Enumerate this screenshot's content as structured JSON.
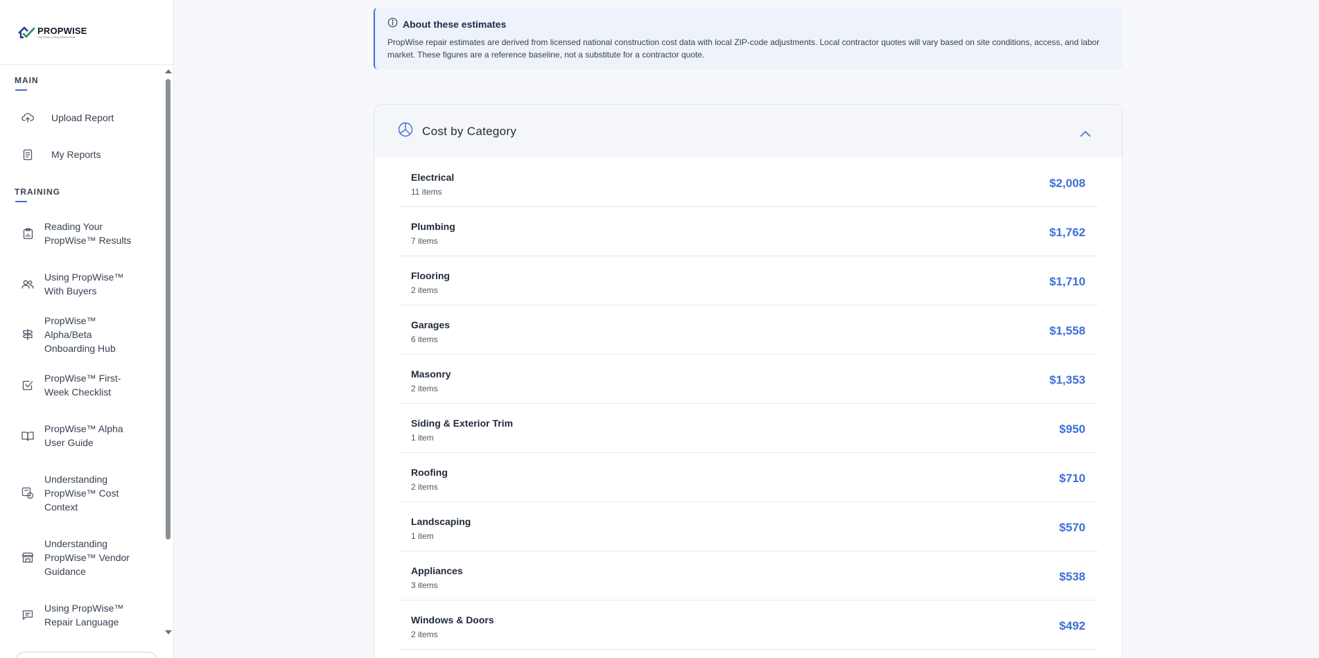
{
  "brand": {
    "name": "PROPWISE",
    "tagline": "The Power to Buy What's Real"
  },
  "sidebar": {
    "sections": [
      {
        "label": "MAIN"
      },
      {
        "label": "TRAINING"
      }
    ],
    "main_items": [
      {
        "label": "Upload Report",
        "icon": "upload-cloud-icon"
      },
      {
        "label": "My Reports",
        "icon": "document-icon"
      }
    ],
    "training_items": [
      {
        "label": "Reading Your PropWise™ Results",
        "icon": "report-chart-icon"
      },
      {
        "label": "Using PropWise™ With Buyers",
        "icon": "users-icon"
      },
      {
        "label": "PropWise™ Alpha/Beta Onboarding Hub",
        "icon": "signpost-icon"
      },
      {
        "label": "PropWise™ First-Week Checklist",
        "icon": "checkbox-icon"
      },
      {
        "label": "PropWise™ Alpha User Guide",
        "icon": "book-icon"
      },
      {
        "label": "Understanding PropWise™ Cost Context",
        "icon": "cost-calculator-icon"
      },
      {
        "label": "Understanding PropWise™ Vendor Guidance",
        "icon": "storefront-icon"
      },
      {
        "label": "Using PropWise™ Repair Language",
        "icon": "chat-icon"
      }
    ]
  },
  "info": {
    "title": "About these estimates",
    "body": "PropWise repair estimates are derived from licensed national construction cost data with local ZIP-code adjustments. Local contractor quotes will vary based on site conditions, access, and labor market. These figures are a reference baseline, not a substitute for a contractor quote.",
    "accent": "#3b6fd8"
  },
  "cost_card": {
    "title": "Cost by Category",
    "rows": [
      {
        "name": "Electrical",
        "count": "11 items",
        "amount": "$2,008"
      },
      {
        "name": "Plumbing",
        "count": "7 items",
        "amount": "$1,762"
      },
      {
        "name": "Flooring",
        "count": "2 items",
        "amount": "$1,710"
      },
      {
        "name": "Garages",
        "count": "6 items",
        "amount": "$1,558"
      },
      {
        "name": "Masonry",
        "count": "2 items",
        "amount": "$1,353"
      },
      {
        "name": "Siding & Exterior Trim",
        "count": "1 item",
        "amount": "$950"
      },
      {
        "name": "Roofing",
        "count": "2 items",
        "amount": "$710"
      },
      {
        "name": "Landscaping",
        "count": "1 item",
        "amount": "$570"
      },
      {
        "name": "Appliances",
        "count": "3 items",
        "amount": "$538"
      },
      {
        "name": "Windows & Doors",
        "count": "2 items",
        "amount": "$492"
      }
    ]
  }
}
